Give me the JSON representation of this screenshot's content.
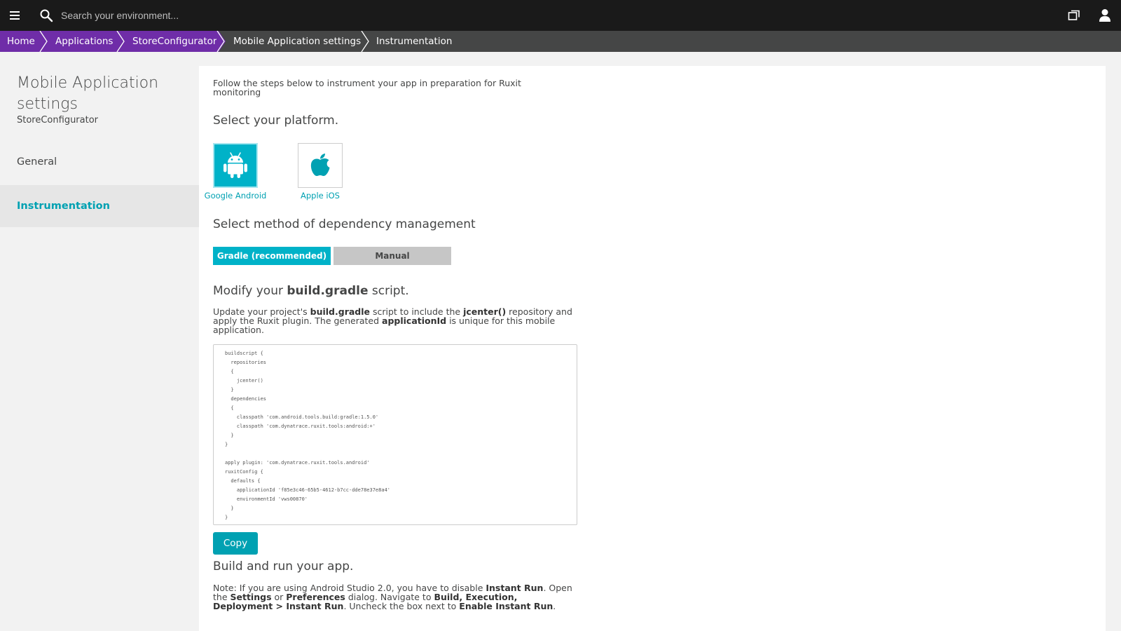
{
  "topbar": {
    "search_placeholder": "Search your environment..."
  },
  "breadcrumb": [
    {
      "label": "Home"
    },
    {
      "label": "Applications"
    },
    {
      "label": "StoreConfigurator"
    },
    {
      "label": "Mobile Application settings"
    },
    {
      "label": "Instrumentation"
    }
  ],
  "sidebar": {
    "title": "Mobile Application settings",
    "subtitle": "StoreConfigurator",
    "items": [
      {
        "label": "General"
      },
      {
        "label": "Instrumentation"
      }
    ]
  },
  "main": {
    "intro": "Follow the steps below to instrument your app in preparation for Ruxit monitoring",
    "platform_heading": "Select your platform.",
    "platforms": [
      {
        "label": "Google Android",
        "icon": "android-icon",
        "selected": true
      },
      {
        "label": "Apple iOS",
        "icon": "apple-icon",
        "selected": false
      }
    ],
    "dependency_heading": "Select method of dependency management",
    "dependency_options": [
      {
        "label": "Gradle (recommended)",
        "selected": true
      },
      {
        "label": "Manual",
        "selected": false
      }
    ],
    "modify_heading_pre": "Modify your ",
    "modify_heading_bold": "build.gradle",
    "modify_heading_post": " script.",
    "update_desc": {
      "p1": "Update your project's ",
      "b1": "build.gradle",
      "p2": " script to include the ",
      "b2": "jcenter()",
      "p3": " repository and apply the Ruxit plugin. The generated ",
      "b3": "applicationId",
      "p4": " is unique for this mobile application."
    },
    "code": "buildscript {\n  repositories\n  {\n    jcenter()\n  }\n  dependencies\n  {\n    classpath 'com.android.tools.build:gradle:1.5.0'\n    classpath 'com.dynatrace.ruxit.tools:android:+'\n  }\n}\n\napply plugin: 'com.dynatrace.ruxit.tools.android'\nruxitConfig {\n  defaults {\n    applicationId 'f85e3c46-65b5-4612-b7cc-dde78e37e8a4'\n    environmentId 'vws00870'\n  }\n}",
    "copy_label": "Copy",
    "build_heading": "Build and run your app.",
    "note": {
      "p1": "Note: If you are using Android Studio 2.0, you have to disable ",
      "b1": "Instant Run",
      "p2": ". Open the ",
      "b2": "Settings",
      "p3": " or ",
      "b3": "Preferences",
      "p4": " dialog. Navigate to ",
      "b4": "Build, Execution, Deployment > Instant Run",
      "p5": ". Uncheck the box next to ",
      "b5": "Enable Instant Run",
      "p6": "."
    }
  },
  "colors": {
    "accent": "#00b2c8",
    "link": "#00a1b2",
    "breadcrumb_purple": "#6f2da8",
    "topbar": "#1a1a1a"
  }
}
